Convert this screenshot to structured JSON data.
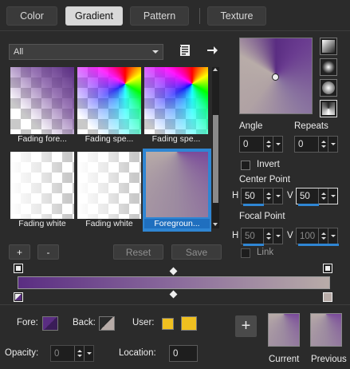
{
  "tabs": [
    {
      "label": "Color"
    },
    {
      "label": "Gradient"
    },
    {
      "label": "Pattern"
    },
    {
      "label": "Texture"
    }
  ],
  "filter": {
    "selected": "All"
  },
  "gradients": [
    {
      "name": "Fading fore..."
    },
    {
      "name": "Fading spe..."
    },
    {
      "name": "Fading spe..."
    },
    {
      "name": "Fading white"
    },
    {
      "name": "Fading white"
    },
    {
      "name": "Foregroun..."
    }
  ],
  "buttons": {
    "add": "+",
    "remove": "-",
    "reset": "Reset",
    "save": "Save"
  },
  "angle": {
    "label": "Angle",
    "value": "0"
  },
  "repeats": {
    "label": "Repeats",
    "value": "0"
  },
  "invert": {
    "label": "Invert",
    "checked": false
  },
  "center_point": {
    "label": "Center Point",
    "h_label": "H",
    "h_value": "50",
    "v_label": "V",
    "v_value": "50"
  },
  "focal_point": {
    "label": "Focal Point",
    "h_label": "H",
    "h_value": "50",
    "v_label": "V",
    "v_value": "100"
  },
  "link": {
    "label": "Link",
    "checked": false
  },
  "colors": {
    "fore_label": "Fore:",
    "back_label": "Back:",
    "user_label": "User:",
    "purple": "#5a2d82",
    "beige": "#b8aca8",
    "user_color": "#f0c020",
    "selection_blue": "#2f86d3"
  },
  "opacity": {
    "label": "Opacity:",
    "value": "0"
  },
  "location": {
    "label": "Location:",
    "value": "0"
  },
  "preview": {
    "current_label": "Current",
    "previous_label": "Previous",
    "add_symbol": "+"
  }
}
